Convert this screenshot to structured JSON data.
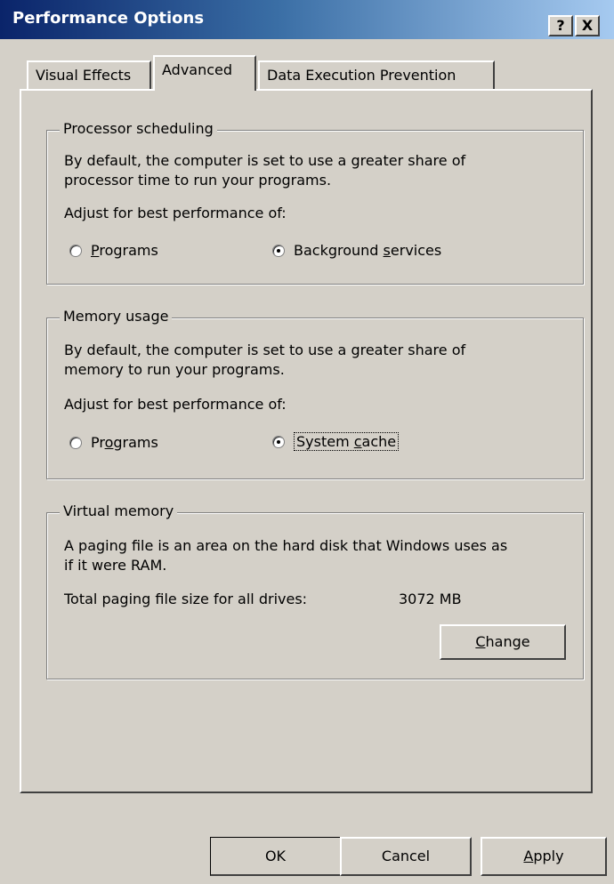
{
  "window": {
    "title": "Performance Options",
    "help_label": "?",
    "close_label": "X"
  },
  "tabs": [
    {
      "label": "Visual Effects",
      "selected": false
    },
    {
      "label": "Advanced",
      "selected": true
    },
    {
      "label": "Data Execution Prevention",
      "selected": false
    }
  ],
  "processor": {
    "legend": "Processor scheduling",
    "desc_line1": "By default, the computer is set to use a greater share of",
    "desc_line2": "processor time to run your programs.",
    "adjust": "Adjust for best performance of:",
    "opt_programs_u": "P",
    "opt_programs_rest": "rograms",
    "opt_background_pre": "Background ",
    "opt_background_u": "s",
    "opt_background_rest": "ervices",
    "selected": "Background services"
  },
  "memory": {
    "legend": "Memory usage",
    "desc_line1": "By default, the computer is set to use a greater share of",
    "desc_line2": "memory to run your programs.",
    "adjust": "Adjust for best performance of:",
    "opt_programs_pre": "Pr",
    "opt_programs_u": "o",
    "opt_programs_rest": "grams",
    "opt_cache_pre": "System ",
    "opt_cache_u": "c",
    "opt_cache_rest": "ache",
    "selected": "System cache"
  },
  "virtual": {
    "legend": "Virtual memory",
    "desc_line1": "A paging file is an area on the hard disk that Windows uses as",
    "desc_line2": "if it were RAM.",
    "total_label": "Total paging file size for all drives:",
    "total_value": "3072 MB",
    "change_u": "C",
    "change_rest": "hange"
  },
  "footer": {
    "ok_label": "OK",
    "cancel_label": "Cancel",
    "apply_u": "A",
    "apply_rest": "pply"
  }
}
